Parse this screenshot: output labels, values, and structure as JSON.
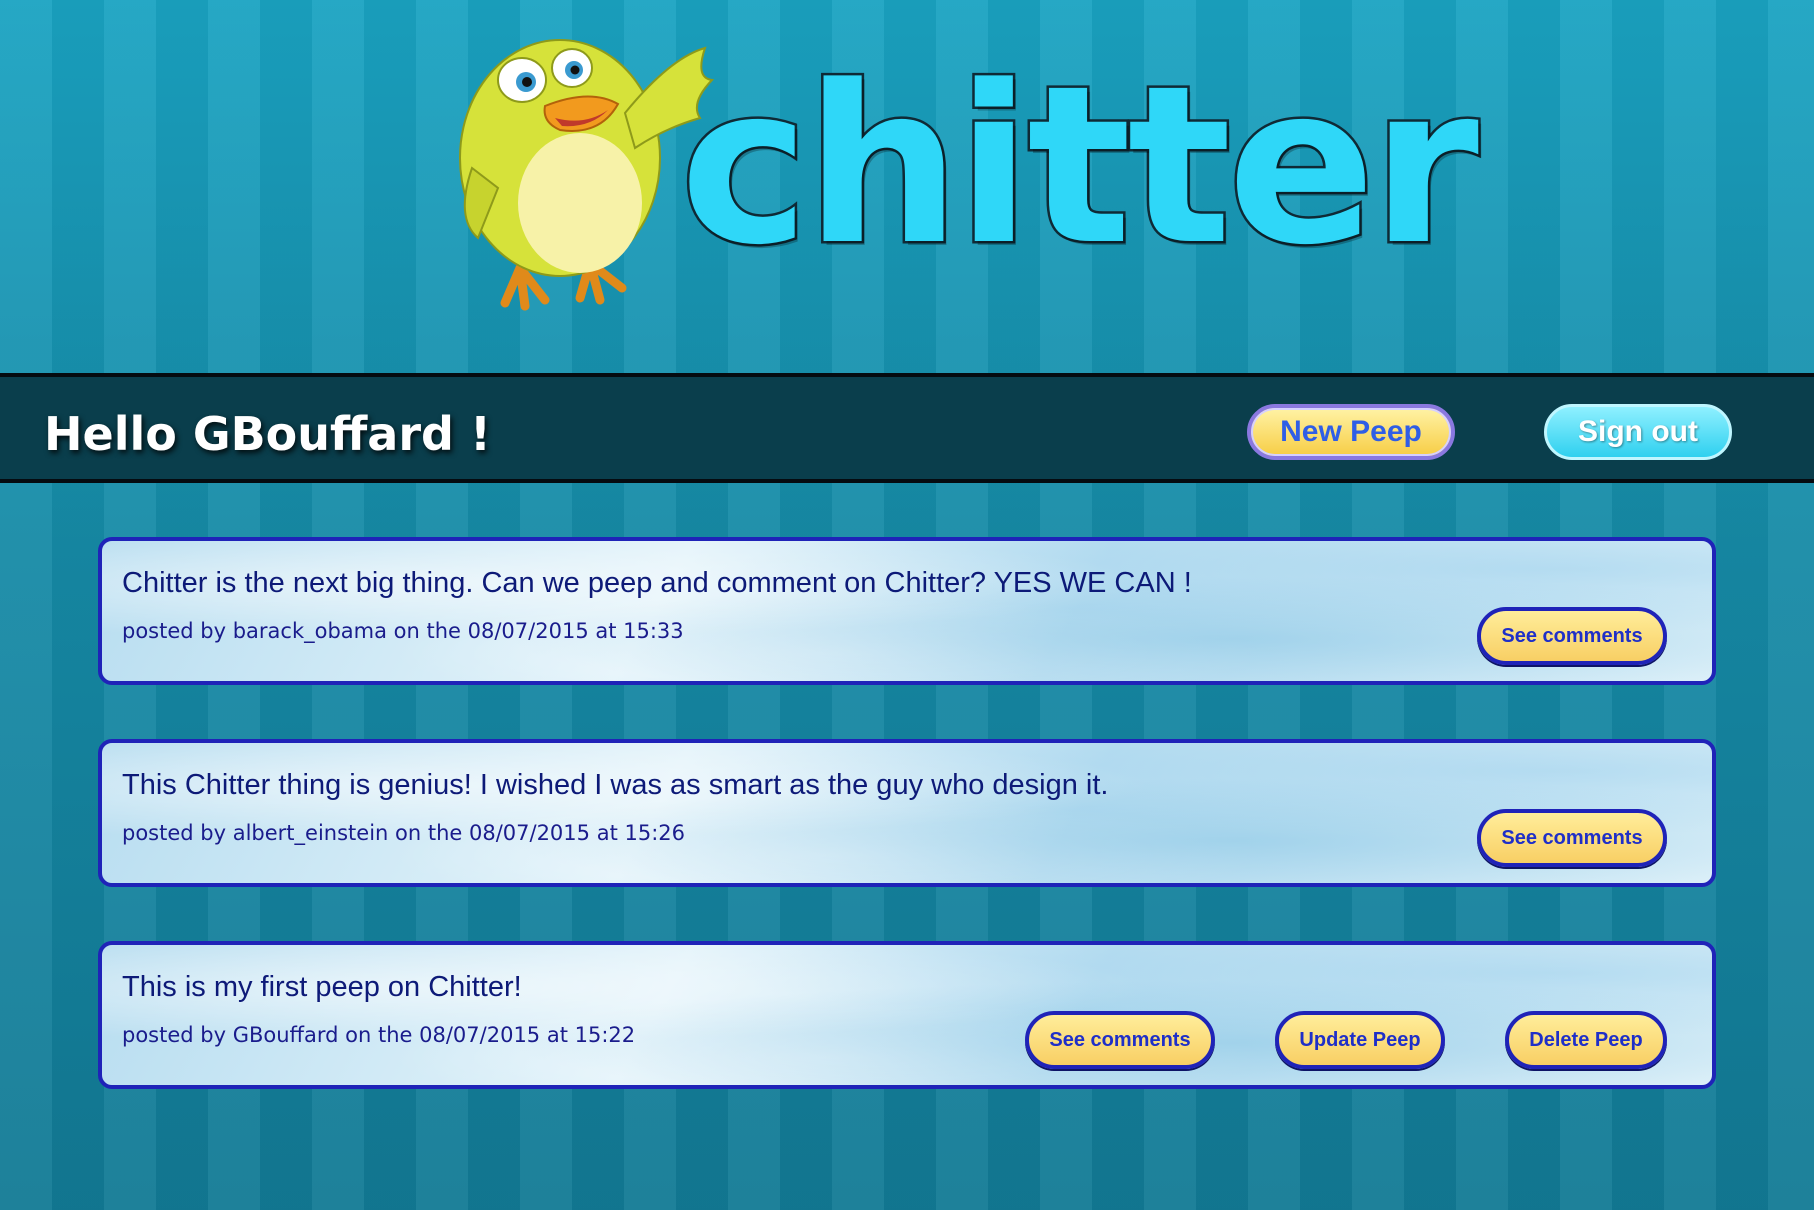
{
  "logo": {
    "wordmark": "chitter",
    "mascot_icon": "bird-mascot-icon"
  },
  "header": {
    "greeting": "Hello GBouffard !",
    "new_peep_label": "New Peep",
    "sign_out_label": "Sign out"
  },
  "peeps": [
    {
      "text": "Chitter is the next big thing. Can we peep and comment on Chitter? YES WE CAN !",
      "meta": "posted by barack_obama on the 08/07/2015 at 15:33",
      "see_comments_label": "See comments"
    },
    {
      "text": "This Chitter thing is genius! I wished I was as smart as the guy who design it.",
      "meta": "posted by albert_einstein on the 08/07/2015 at 15:26",
      "see_comments_label": "See comments"
    },
    {
      "text": "This is my first peep on Chitter!",
      "meta": "posted by GBouffard on the 08/07/2015 at 15:22",
      "see_comments_label": "See comments",
      "update_label": "Update Peep",
      "delete_label": "Delete Peep"
    }
  ],
  "colors": {
    "background": "#17879f",
    "header_bar": "#0a3e4c",
    "peep_border": "#1f23b8",
    "button_yellow": "#f8cf64",
    "wordmark_cyan": "#2fd7f8"
  }
}
